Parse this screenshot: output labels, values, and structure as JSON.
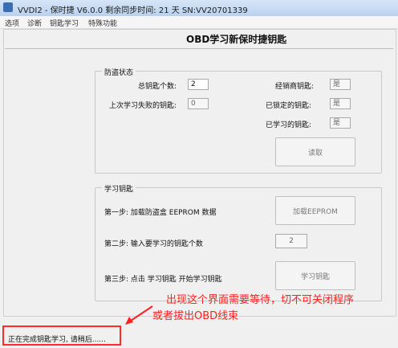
{
  "window": {
    "title": "VVDI2 - 保时捷 V6.0.0      剩余同步时间: 21 天      SN:VV20701339"
  },
  "menu": {
    "items": [
      "选项",
      "诊断",
      "钥匙学习",
      "特殊功能"
    ]
  },
  "page": {
    "title": "OBD学习新保时捷钥匙"
  },
  "immobilizer_group": {
    "legend": "防盗状态",
    "total_keys_label": "总钥匙个数:",
    "total_keys_value": "2",
    "last_failed_label": "上次学习失败的钥匙:",
    "last_failed_value": "0",
    "dealer_key_label": "经销商钥匙:",
    "dealer_key_value": "是",
    "locked_key_label": "已锁定的钥匙:",
    "locked_key_value": "是",
    "learned_key_label": "已学习的钥匙:",
    "learned_key_value": "是",
    "read_button": "读取"
  },
  "learn_group": {
    "legend": "学习钥匙",
    "step1_label": "第一步: 加载防盗盒 EEPROM 数据",
    "step1_button": "加载EEPROM",
    "step2_label": "第二步: 输入要学习的钥匙个数",
    "step2_value": "2",
    "step3_label": "第三步: 点击 学习钥匙 开始学习钥匙",
    "step3_button": "学习钥匙"
  },
  "annotation": {
    "line1": "出现这个界面需要等待，切不可关闭程序",
    "line2": "或者拔出OBD线束"
  },
  "status": {
    "text": "正在完成钥匙学习, 请稍后......"
  },
  "colors": {
    "annotation": "#ff2020"
  }
}
